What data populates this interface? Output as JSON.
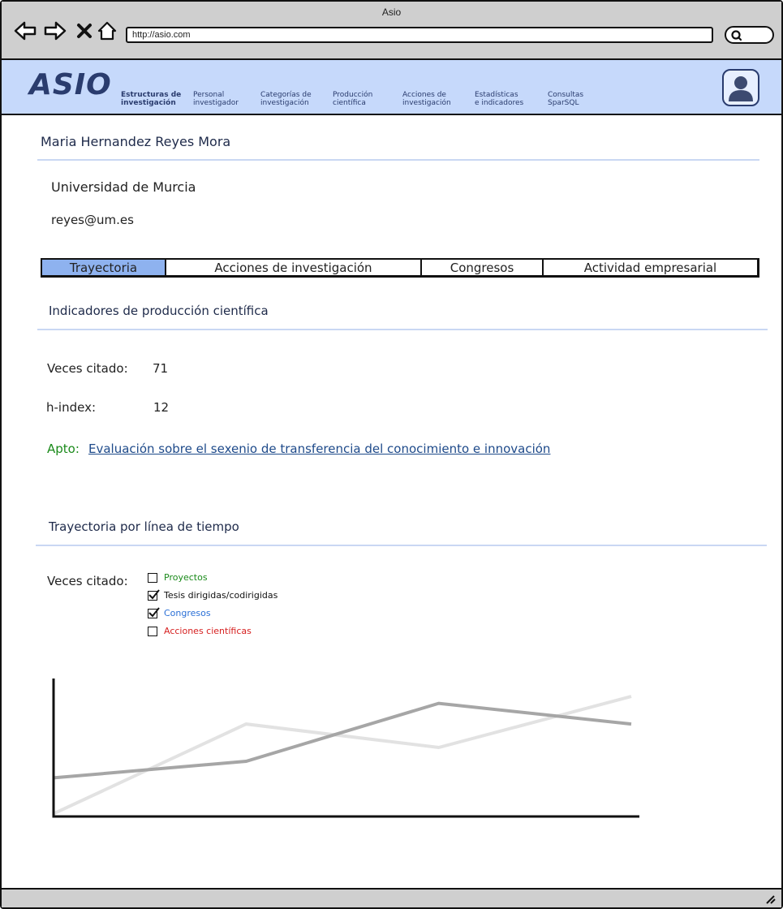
{
  "window": {
    "title": "Asio"
  },
  "browser": {
    "url": "http://asio.com"
  },
  "app": {
    "logo": "ASIO",
    "nav": [
      {
        "label": "Estructuras de\ninvestigación",
        "active": true
      },
      {
        "label": "Personal\ninvestigador",
        "active": false
      },
      {
        "label": "Categorías de\ninvestigación",
        "active": false
      },
      {
        "label": "Producción\ncientífica",
        "active": false
      },
      {
        "label": "Acciones de\ninvestigación",
        "active": false
      },
      {
        "label": "Estadísticas\ne indicadores",
        "active": false
      },
      {
        "label": "Consultas\nSparSQL",
        "active": false
      }
    ]
  },
  "profile": {
    "name": "Maria Hernandez Reyes Mora",
    "university": "Universidad de Murcia",
    "email": "reyes@um.es"
  },
  "tabs": [
    {
      "label": "Trayectoria",
      "active": true
    },
    {
      "label": "Acciones de investigación",
      "active": false
    },
    {
      "label": "Congresos",
      "active": false
    },
    {
      "label": "Actividad empresarial",
      "active": false
    }
  ],
  "indicators": {
    "title": "Indicadores de producción científica",
    "citations_label": "Veces citado:",
    "citations_value": "71",
    "hindex_label": "h-index:",
    "hindex_value": "12",
    "apto_label": "Apto:",
    "apto_link": "Evaluación sobre el sexenio de transferencia del conocimiento e innovación"
  },
  "timeline": {
    "title": "Trayectoria por línea de tiempo",
    "label": "Veces citado:",
    "filters": [
      {
        "label": "Proyectos",
        "checked": false,
        "color": "#1a8a1a"
      },
      {
        "label": "Tesis dirigidas/codirigidas",
        "checked": true,
        "color": "#111111"
      },
      {
        "label": "Congresos",
        "checked": true,
        "color": "#2a6fd6"
      },
      {
        "label": "Acciones científicas",
        "checked": false,
        "color": "#d62020"
      }
    ]
  },
  "chart_data": {
    "type": "line",
    "title": "",
    "xlabel": "",
    "ylabel": "",
    "x": [
      0,
      1,
      2,
      3
    ],
    "ylim": [
      0,
      100
    ],
    "grid": false,
    "series": [
      {
        "color": "#a6a6a6",
        "values": [
          28,
          40,
          82,
          67
        ]
      },
      {
        "color": "#e2e2e2",
        "values": [
          2,
          67,
          50,
          87
        ]
      }
    ]
  }
}
